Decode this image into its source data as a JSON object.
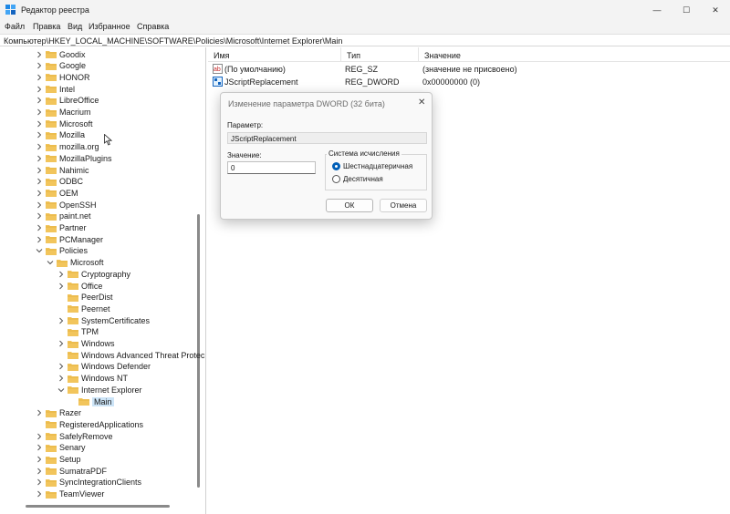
{
  "window": {
    "title": "Редактор реестра",
    "minimize_label": "—",
    "maximize_label": "☐",
    "close_label": "✕"
  },
  "menu": [
    "Файл",
    "Правка",
    "Вид",
    "Избранное",
    "Справка"
  ],
  "address": "Компьютер\\HKEY_LOCAL_MACHINE\\SOFTWARE\\Policies\\Microsoft\\Internet Explorer\\Main",
  "tree": [
    {
      "label": "Goodix",
      "level": 0,
      "state": "collapsed"
    },
    {
      "label": "Google",
      "level": 0,
      "state": "collapsed"
    },
    {
      "label": "HONOR",
      "level": 0,
      "state": "collapsed"
    },
    {
      "label": "Intel",
      "level": 0,
      "state": "collapsed"
    },
    {
      "label": "LibreOffice",
      "level": 0,
      "state": "collapsed"
    },
    {
      "label": "Macrium",
      "level": 0,
      "state": "collapsed"
    },
    {
      "label": "Microsoft",
      "level": 0,
      "state": "collapsed"
    },
    {
      "label": "Mozilla",
      "level": 0,
      "state": "collapsed"
    },
    {
      "label": "mozilla.org",
      "level": 0,
      "state": "collapsed"
    },
    {
      "label": "MozillaPlugins",
      "level": 0,
      "state": "collapsed"
    },
    {
      "label": "Nahimic",
      "level": 0,
      "state": "collapsed"
    },
    {
      "label": "ODBC",
      "level": 0,
      "state": "collapsed"
    },
    {
      "label": "OEM",
      "level": 0,
      "state": "collapsed"
    },
    {
      "label": "OpenSSH",
      "level": 0,
      "state": "collapsed"
    },
    {
      "label": "paint.net",
      "level": 0,
      "state": "collapsed"
    },
    {
      "label": "Partner",
      "level": 0,
      "state": "collapsed"
    },
    {
      "label": "PCManager",
      "level": 0,
      "state": "collapsed"
    },
    {
      "label": "Policies",
      "level": 0,
      "state": "expanded"
    },
    {
      "label": "Microsoft",
      "level": 1,
      "state": "expanded"
    },
    {
      "label": "Cryptography",
      "level": 2,
      "state": "collapsed"
    },
    {
      "label": "Office",
      "level": 2,
      "state": "collapsed"
    },
    {
      "label": "PeerDist",
      "level": 2,
      "state": "none"
    },
    {
      "label": "Peernet",
      "level": 2,
      "state": "none"
    },
    {
      "label": "SystemCertificates",
      "level": 2,
      "state": "collapsed"
    },
    {
      "label": "TPM",
      "level": 2,
      "state": "none"
    },
    {
      "label": "Windows",
      "level": 2,
      "state": "collapsed"
    },
    {
      "label": "Windows Advanced Threat Protec",
      "level": 2,
      "state": "none"
    },
    {
      "label": "Windows Defender",
      "level": 2,
      "state": "collapsed"
    },
    {
      "label": "Windows NT",
      "level": 2,
      "state": "collapsed"
    },
    {
      "label": "Internet Explorer",
      "level": 2,
      "state": "expanded"
    },
    {
      "label": "Main",
      "level": 3,
      "state": "none",
      "selected": true
    },
    {
      "label": "Razer",
      "level": 0,
      "state": "collapsed"
    },
    {
      "label": "RegisteredApplications",
      "level": 0,
      "state": "none"
    },
    {
      "label": "SafelyRemove",
      "level": 0,
      "state": "collapsed"
    },
    {
      "label": "Senary",
      "level": 0,
      "state": "collapsed"
    },
    {
      "label": "Setup",
      "level": 0,
      "state": "collapsed"
    },
    {
      "label": "SumatraPDF",
      "level": 0,
      "state": "collapsed"
    },
    {
      "label": "SyncIntegrationClients",
      "level": 0,
      "state": "collapsed"
    },
    {
      "label": "TeamViewer",
      "level": 0,
      "state": "collapsed"
    }
  ],
  "columns": {
    "name": "Имя",
    "type": "Тип",
    "value": "Значение"
  },
  "values": [
    {
      "icon": "string-value-icon",
      "name": "(По умолчанию)",
      "type": "REG_SZ",
      "data": "(значение не присвоено)"
    },
    {
      "icon": "binary-value-icon",
      "name": "JScriptReplacement",
      "type": "REG_DWORD",
      "data": "0x00000000 (0)"
    }
  ],
  "dialog": {
    "title": "Изменение параметра DWORD (32 бита)",
    "close_label": "✕",
    "name_label": "Параметр:",
    "name_value": "JScriptReplacement",
    "value_label": "Значение:",
    "value_value": "0",
    "base_label": "Система исчисления",
    "hex_label": "Шестнадцатеричная",
    "dec_label": "Десятичная",
    "selected_base": "hex",
    "ok_label": "ОК",
    "cancel_label": "Отмена"
  },
  "colors": {
    "accent": "#005fb8",
    "folder": "#f2c55c",
    "selection": "#cce4f7"
  }
}
